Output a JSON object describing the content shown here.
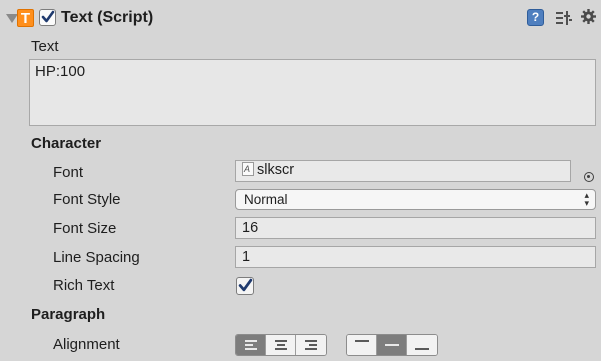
{
  "component": {
    "title": "Text (Script)",
    "icon_letter": "T",
    "enabled": true,
    "icons": [
      "help-icon",
      "preset-icon",
      "gear-icon"
    ]
  },
  "text_field": {
    "label": "Text",
    "value": "HP:100"
  },
  "character": {
    "section_label": "Character",
    "font_label": "Font",
    "font_value": "slkscr",
    "font_style_label": "Font Style",
    "font_style_value": "Normal",
    "font_size_label": "Font Size",
    "font_size_value": "16",
    "line_spacing_label": "Line Spacing",
    "line_spacing_value": "1",
    "rich_text_label": "Rich Text",
    "rich_text_checked": true
  },
  "paragraph": {
    "section_label": "Paragraph",
    "alignment_label": "Alignment",
    "horizontal_options": [
      "left",
      "center",
      "right"
    ],
    "horizontal_selected": "left",
    "vertical_options": [
      "top",
      "middle",
      "bottom"
    ],
    "vertical_selected": "middle"
  },
  "colors": {
    "panel_bg": "#d6d6d6",
    "component_icon": "#ff8f1c",
    "field_bg": "#e9e9e9",
    "selected_toggle": "#7d7d7d"
  }
}
